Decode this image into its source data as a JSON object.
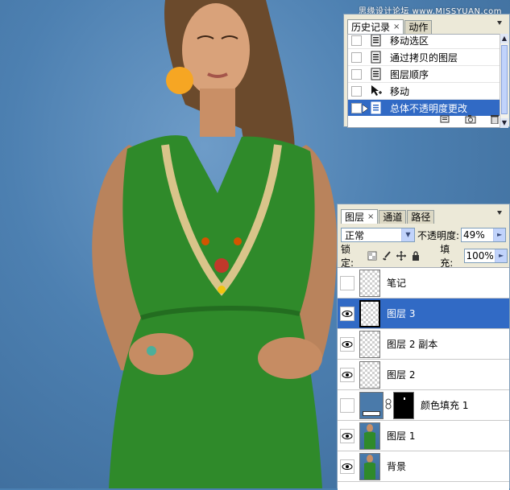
{
  "watermark": "思缘设计论坛 www.MISSYUAN.com",
  "colors": {
    "background_blue": "#4d80b1",
    "dress_green": "#2f8a2a",
    "dot_orange": "#f6a623",
    "selection": "#316ac5",
    "panel": "#ece9d8"
  },
  "history_panel": {
    "tabs": [
      {
        "label": "历史记录",
        "active": true,
        "close": "×"
      },
      {
        "label": "动作",
        "active": false
      }
    ],
    "items": [
      {
        "label": "移动选区",
        "icon": "history-state-icon",
        "selected": false
      },
      {
        "label": "通过拷贝的图层",
        "icon": "history-state-icon",
        "selected": false
      },
      {
        "label": "图层顺序",
        "icon": "history-state-icon",
        "selected": false
      },
      {
        "label": "移动",
        "icon": "move-tool-icon",
        "selected": false
      },
      {
        "label": "总体不透明度更改",
        "icon": "history-state-icon",
        "selected": true
      }
    ],
    "footer_icons": [
      "new-document-icon",
      "snapshot-camera-icon",
      "trash-icon"
    ]
  },
  "layers_panel": {
    "tabs": [
      {
        "label": "图层",
        "active": true,
        "close": "×"
      },
      {
        "label": "通道",
        "active": false
      },
      {
        "label": "路径",
        "active": false
      }
    ],
    "blend_mode": "正常",
    "opacity_label": "不透明度:",
    "opacity_value": "49%",
    "lock_label": "锁定:",
    "fill_label": "填充:",
    "fill_value": "100%",
    "layers": [
      {
        "name": "笔记",
        "visible": false,
        "thumb": "transparent",
        "selected": false
      },
      {
        "name": "图层 3",
        "visible": true,
        "thumb": "transparent",
        "selected": true
      },
      {
        "name": "图层 2 副本",
        "visible": true,
        "thumb": "transparent",
        "selected": false
      },
      {
        "name": "图层 2",
        "visible": true,
        "thumb": "transparent",
        "selected": false
      },
      {
        "name": "颜色填充 1",
        "visible": false,
        "thumb": "fill",
        "selected": false
      },
      {
        "name": "图层 1",
        "visible": true,
        "thumb": "photo",
        "selected": false
      },
      {
        "name": "背景",
        "visible": true,
        "thumb": "photo",
        "selected": false
      }
    ]
  }
}
